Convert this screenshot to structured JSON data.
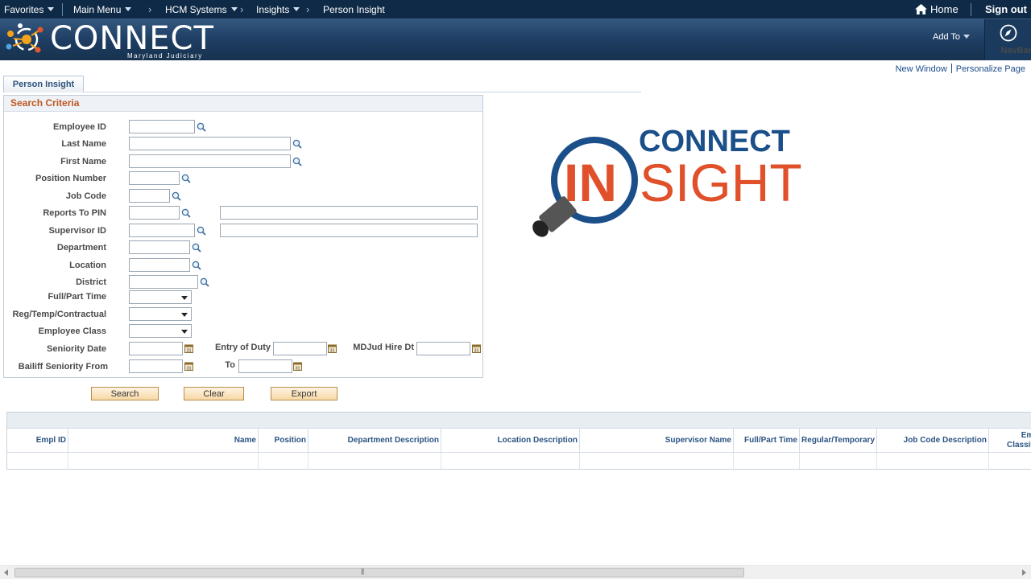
{
  "topnav": {
    "favorites": "Favorites",
    "main_menu": "Main Menu",
    "breadcrumbs": [
      "HCM Systems",
      "Insights",
      "Person Insight"
    ],
    "home": "Home",
    "sign_out": "Sign out"
  },
  "header": {
    "logo_text": "CONNECT",
    "logo_subtitle": "Maryland Judiciary",
    "add_to": "Add To",
    "navbar": "NavBar"
  },
  "page_links": {
    "new_window": "New Window",
    "personalize": "Personalize Page"
  },
  "tab": {
    "label": "Person Insight"
  },
  "search": {
    "title": "Search Criteria",
    "labels": {
      "employee_id": "Employee ID",
      "last_name": "Last Name",
      "first_name": "First Name",
      "position_number": "Position Number",
      "job_code": "Job Code",
      "reports_to_pin": "Reports To PIN",
      "supervisor_id": "Supervisor ID",
      "department": "Department",
      "location": "Location",
      "district": "District",
      "full_part_time": "Full/Part Time",
      "reg_temp": "Reg/Temp/Contractual",
      "employee_class": "Employee Class",
      "seniority_date": "Seniority Date",
      "entry_of_duty": "Entry of Duty",
      "mdjud_hire_dt": "MDJud Hire Dt",
      "bailiff_from": "Bailiff Seniority From",
      "to": "To"
    },
    "values": {
      "employee_id": "",
      "last_name": "",
      "first_name": "",
      "position_number": "",
      "job_code": "",
      "reports_to_pin": "",
      "reports_to_name": "",
      "supervisor_id": "",
      "supervisor_name": "",
      "department": "",
      "location": "",
      "district": "",
      "seniority_date": "",
      "entry_of_duty": "",
      "mdjud_hire_dt": "",
      "bailiff_from": "",
      "bailiff_to": ""
    },
    "selects": {
      "full_part_time": "",
      "reg_temp": "",
      "employee_class": ""
    }
  },
  "buttons": {
    "search": "Search",
    "clear": "Clear",
    "export": "Export"
  },
  "grid": {
    "columns": [
      "Empl ID",
      "Name",
      "Position",
      "Department Description",
      "Location Description",
      "Supervisor Name",
      "Full/Part Time",
      "Regular/Temporary",
      "Job Code Description",
      "Employee Classification"
    ],
    "rows": []
  },
  "insight_logo": {
    "top": "CONNECT",
    "in": "IN",
    "rest": "SIGHT"
  },
  "colors": {
    "nav_bg": "#0f2a47",
    "accent_orange": "#e0502a",
    "logo_blue": "#1b4f8a",
    "link": "#1b4d89"
  }
}
